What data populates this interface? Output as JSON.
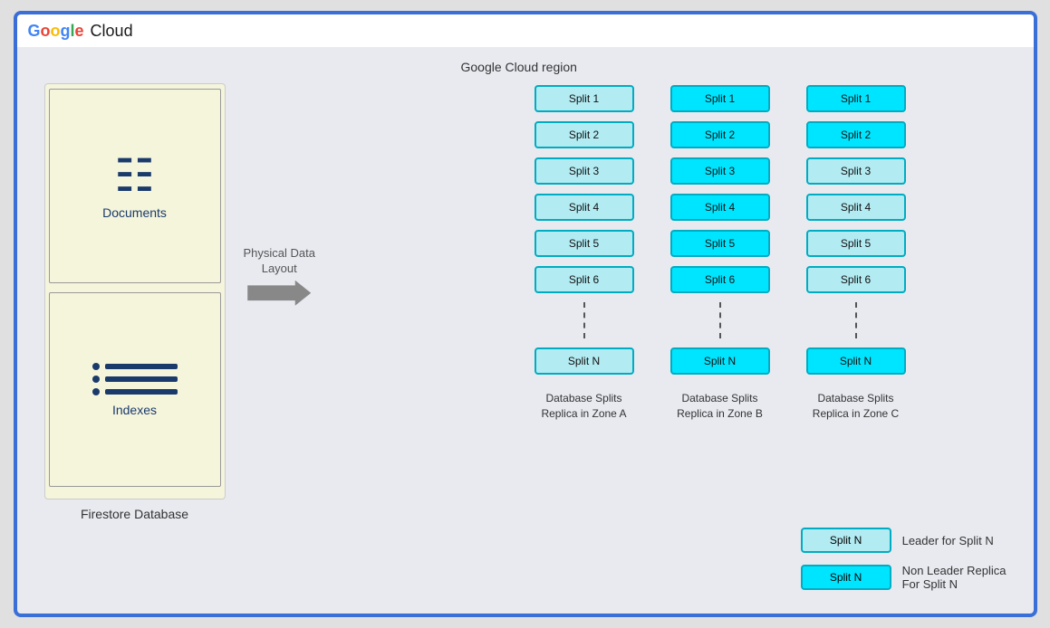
{
  "header": {
    "logo_text": "Google Cloud"
  },
  "region": {
    "label": "Google Cloud region"
  },
  "firestore": {
    "documents_label": "Documents",
    "indexes_label": "Indexes",
    "db_label": "Firestore Database"
  },
  "arrow": {
    "label": "Physical Data\nLayout"
  },
  "zones": [
    {
      "id": "zone_a",
      "splits": [
        "Split 1",
        "Split 2",
        "Split 3",
        "Split 4",
        "Split 5",
        "Split 6",
        "Split N"
      ],
      "types": [
        "leader",
        "leader",
        "leader",
        "leader",
        "leader",
        "leader",
        "leader"
      ],
      "label": "Database Splits\nReplica in Zone A"
    },
    {
      "id": "zone_b",
      "splits": [
        "Split 1",
        "Split 2",
        "Split 3",
        "Split 4",
        "Split 5",
        "Split 6",
        "Split N"
      ],
      "types": [
        "replica",
        "replica",
        "replica",
        "replica",
        "replica",
        "replica",
        "replica"
      ],
      "label": "Database Splits\nReplica in Zone B"
    },
    {
      "id": "zone_c",
      "splits": [
        "Split 1",
        "Split 2",
        "Split 3",
        "Split 4",
        "Split 5",
        "Split 6",
        "Split N"
      ],
      "types": [
        "replica",
        "replica",
        "leader",
        "leader",
        "leader",
        "leader",
        "replica"
      ],
      "label": "Database Splits\nReplica in Zone C"
    }
  ],
  "legend": [
    {
      "label": "Split N",
      "type": "leader",
      "description": "Leader for Split N"
    },
    {
      "label": "Split N",
      "type": "replica",
      "description": "Non Leader Replica\nFor Split N"
    }
  ]
}
